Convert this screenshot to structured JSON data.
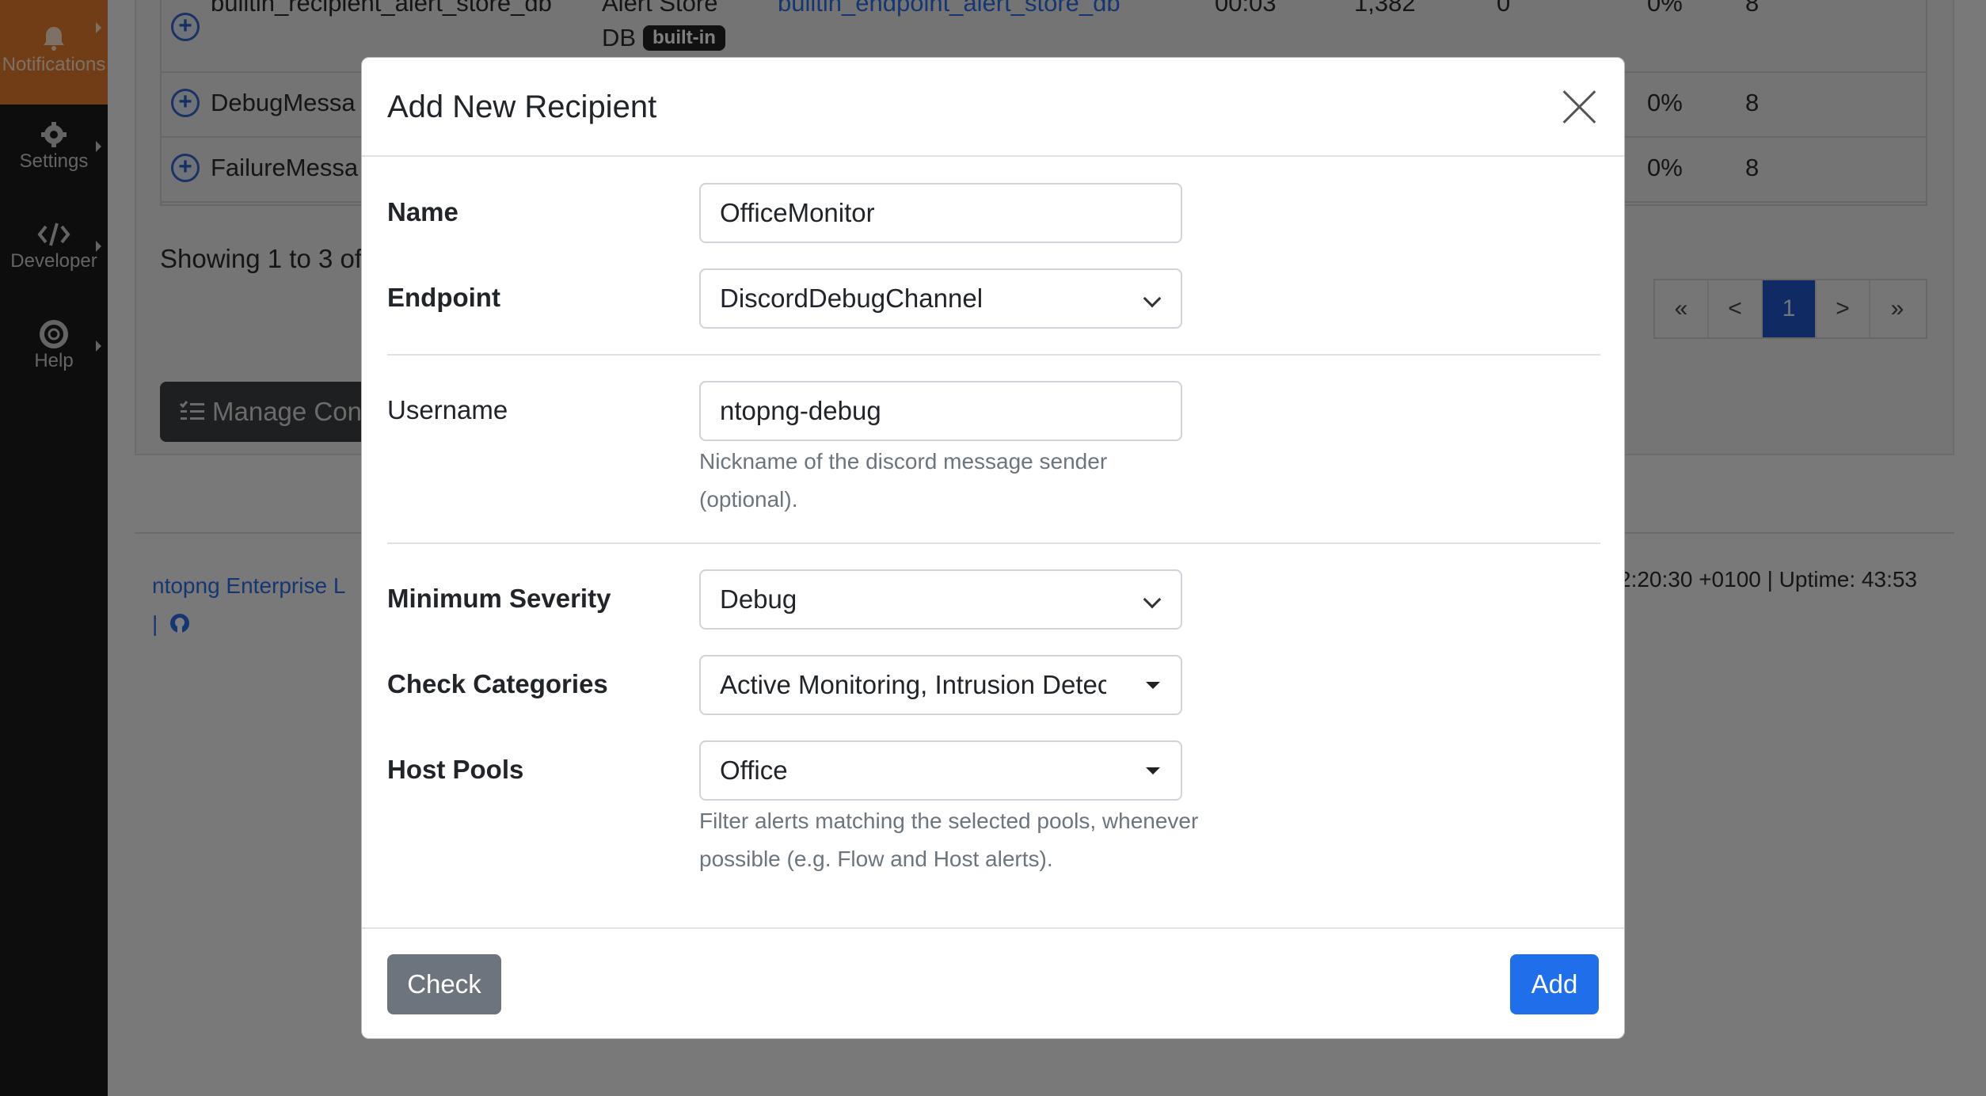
{
  "sidebar": {
    "items": [
      {
        "label": "Notifications",
        "icon": "bell-icon",
        "active": true
      },
      {
        "label": "Settings",
        "icon": "gear-icon"
      },
      {
        "label": "Developer",
        "icon": "code-icon"
      },
      {
        "label": "Help",
        "icon": "lifebuoy-icon"
      }
    ]
  },
  "table": {
    "rows": [
      {
        "name": "builtin_recipient_alert_store_db",
        "type_line1": "Alert Store",
        "type_line2": "DB",
        "badge": "built-in",
        "endpoint": "builtin_endpoint_alert_store_db",
        "uptime": "00:03",
        "count": "1,382",
        "drops": "0",
        "pct": "0%",
        "n": "8"
      },
      {
        "name": "DebugMessa",
        "pct": "0%",
        "n": "8"
      },
      {
        "name": "FailureMessa",
        "pct": "0%",
        "n": "8"
      }
    ],
    "showing": "Showing 1 to 3 of",
    "pager": [
      "«",
      "<",
      "1",
      ">",
      "»"
    ],
    "manage_button": "Manage Con"
  },
  "footer": {
    "left": "ntopng Enterprise L",
    "left2": "|",
    "right": "2:20:30 +0100 | Uptime: 43:53"
  },
  "modal": {
    "title": "Add New Recipient",
    "name_label": "Name",
    "name_value": "OfficeMonitor",
    "endpoint_label": "Endpoint",
    "endpoint_value": "DiscordDebugChannel",
    "username_label": "Username",
    "username_value": "ntopng-debug",
    "username_help": "Nickname of the discord message sender (optional).",
    "severity_label": "Minimum Severity",
    "severity_value": "Debug",
    "categories_label": "Check Categories",
    "categories_value": "Active Monitoring, Intrusion Detection",
    "pools_label": "Host Pools",
    "pools_value": "Office",
    "pools_help": "Filter alerts matching the selected pools, whenever possible (e.g. Flow and Host alerts).",
    "check_button": "Check",
    "add_button": "Add"
  },
  "colors": {
    "accent": "#1f6feb",
    "sidebar_active": "#e07a2d",
    "secondary": "#6c757d"
  }
}
